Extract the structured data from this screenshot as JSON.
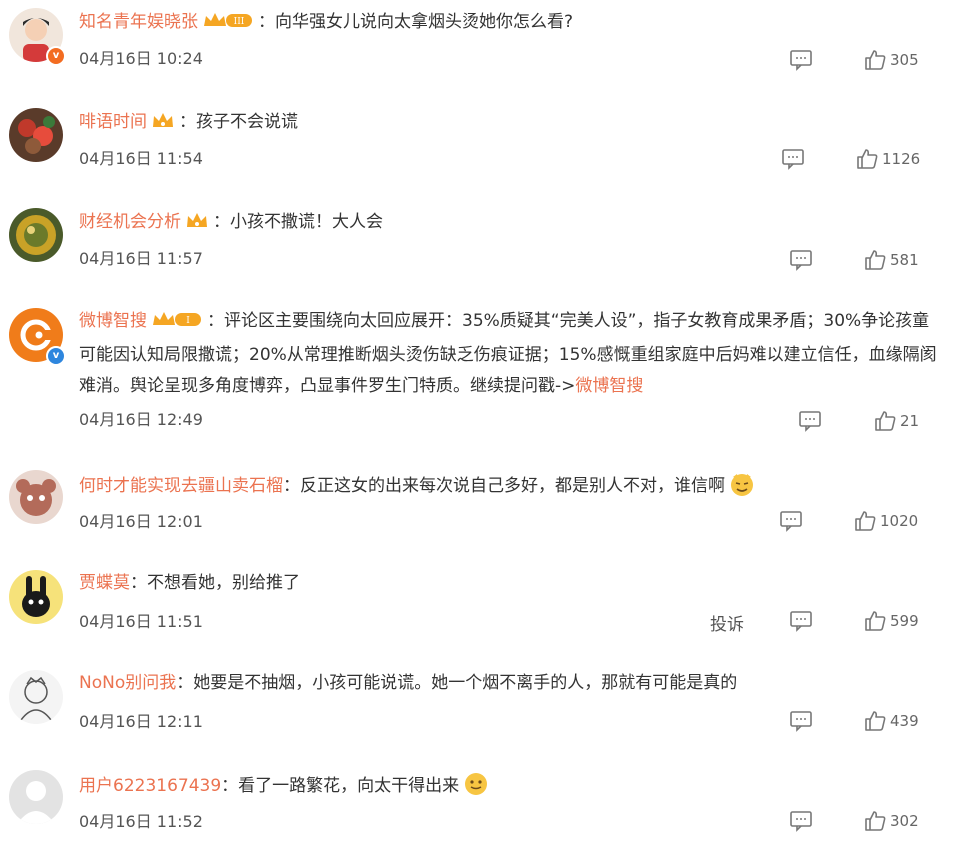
{
  "comments": [
    {
      "user": "知名青年娱晓张",
      "colon": "：",
      "text": "向华强女儿说向太拿烟头烫她你怎么看?",
      "time": "04月16日 10:24",
      "likes": "305"
    },
    {
      "user": "啡语时间",
      "colon": "：",
      "text": "孩子不会说谎",
      "time": "04月16日 11:54",
      "likes": "1126"
    },
    {
      "user": "财经机会分析",
      "colon": "：",
      "text": "小孩不撒谎！大人会",
      "time": "04月16日 11:57",
      "likes": "581"
    },
    {
      "user": "微博智搜",
      "colon": "：",
      "text": "评论区主要围绕向太回应展开：35%质疑其“完美人设”，指子女教育成果矛盾；30%争论孩童可能因认知局限撒谎；20%从常理推断烟头烫伤缺乏伤痕证据；15%感慨重组家庭中后妈难以建立信任，血缘隔阂难消。舆论呈现多角度博弈，凸显事件罗生门特质。继续提问戳->",
      "link": "微博智搜",
      "time": "04月16日 12:49",
      "likes": "21"
    },
    {
      "user": "何时才能实现去疆山卖石榴",
      "colon": "：",
      "text": "反正这女的出来每次说自己多好，都是别人不对，谁信啊",
      "time": "04月16日 12:01",
      "likes": "1020"
    },
    {
      "user": "贾蝶莫",
      "colon": "：",
      "text": "不想看她，别给推了",
      "time": "04月16日 11:51",
      "likes": "599",
      "report": "投诉"
    },
    {
      "user": "NoNo别问我",
      "colon": "：",
      "text": "她要是不抽烟，小孩可能说谎。她一个烟不离手的人，那就有可能是真的",
      "time": "04月16日 12:11",
      "likes": "439"
    },
    {
      "user": "用户6223167439",
      "colon": "：",
      "text": "看了一路繁花，向太干得出来",
      "time": "04月16日 11:52",
      "likes": "302"
    }
  ],
  "badge_labels": {
    "vip3": "III",
    "vip1": "I"
  },
  "colors": {
    "username": "#eb7350",
    "text": "#333333",
    "meta": "#555555"
  },
  "icons": [
    "comment-icon",
    "like-icon",
    "crown-badge-icon",
    "verified-icon",
    "emoji-icon"
  ]
}
